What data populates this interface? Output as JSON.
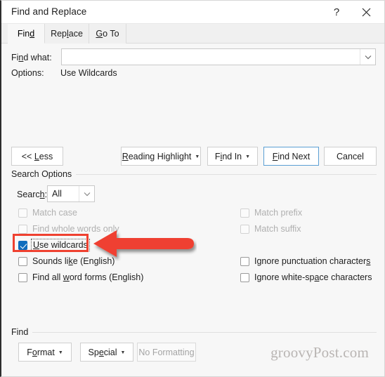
{
  "window": {
    "title": "Find and Replace",
    "help_icon": "question-mark-icon",
    "close_icon": "close-icon"
  },
  "tabs": [
    {
      "label": "Find",
      "accel": "d",
      "active": true
    },
    {
      "label": "Replace",
      "accel": "l",
      "active": false
    },
    {
      "label": "Go To",
      "accel": "G",
      "active": false
    }
  ],
  "find_what": {
    "label": "Find what:",
    "value": "",
    "placeholder": "",
    "dropdown_icon": "chevron-down-icon"
  },
  "options_row": {
    "label": "Options:",
    "value": "Use Wildcards"
  },
  "buttons": {
    "less": "<< Less",
    "reading_highlight": "Reading Highlight",
    "find_in": "Find In",
    "find_next": "Find Next",
    "cancel": "Cancel"
  },
  "search_options": {
    "group_label": "Search Options",
    "search_label": "Search:",
    "search_value": "All",
    "search_dropdown_icon": "chevron-down-icon",
    "left_column": [
      {
        "label": "Match case",
        "checked": false,
        "disabled": true
      },
      {
        "label": "Find whole words only",
        "checked": false,
        "disabled": true
      },
      {
        "label": "Use wildcards",
        "checked": true,
        "disabled": false,
        "focused": true
      },
      {
        "label": "Sounds like (English)",
        "checked": false,
        "disabled": false
      },
      {
        "label": "Find all word forms (English)",
        "checked": false,
        "disabled": false
      }
    ],
    "right_column": [
      {
        "label": "Match prefix",
        "checked": false,
        "disabled": true
      },
      {
        "label": "Match suffix",
        "checked": false,
        "disabled": true
      },
      {
        "label": "Ignore punctuation characters",
        "checked": false,
        "disabled": false
      },
      {
        "label": "Ignore white-space characters",
        "checked": false,
        "disabled": false
      }
    ]
  },
  "find_group": {
    "group_label": "Find",
    "format": "Format",
    "special": "Special",
    "no_formatting": "No Formatting"
  },
  "watermark": "groovyPost.com",
  "annotation": {
    "type": "red-box-and-arrow",
    "target": "Use wildcards",
    "color": "#ef4130"
  },
  "colors": {
    "accent_checkbox": "#0f6cbd",
    "focus_border": "#5a9fd4",
    "annotation_red": "#ef4130",
    "dialog_bg": "#f7f7f7"
  }
}
